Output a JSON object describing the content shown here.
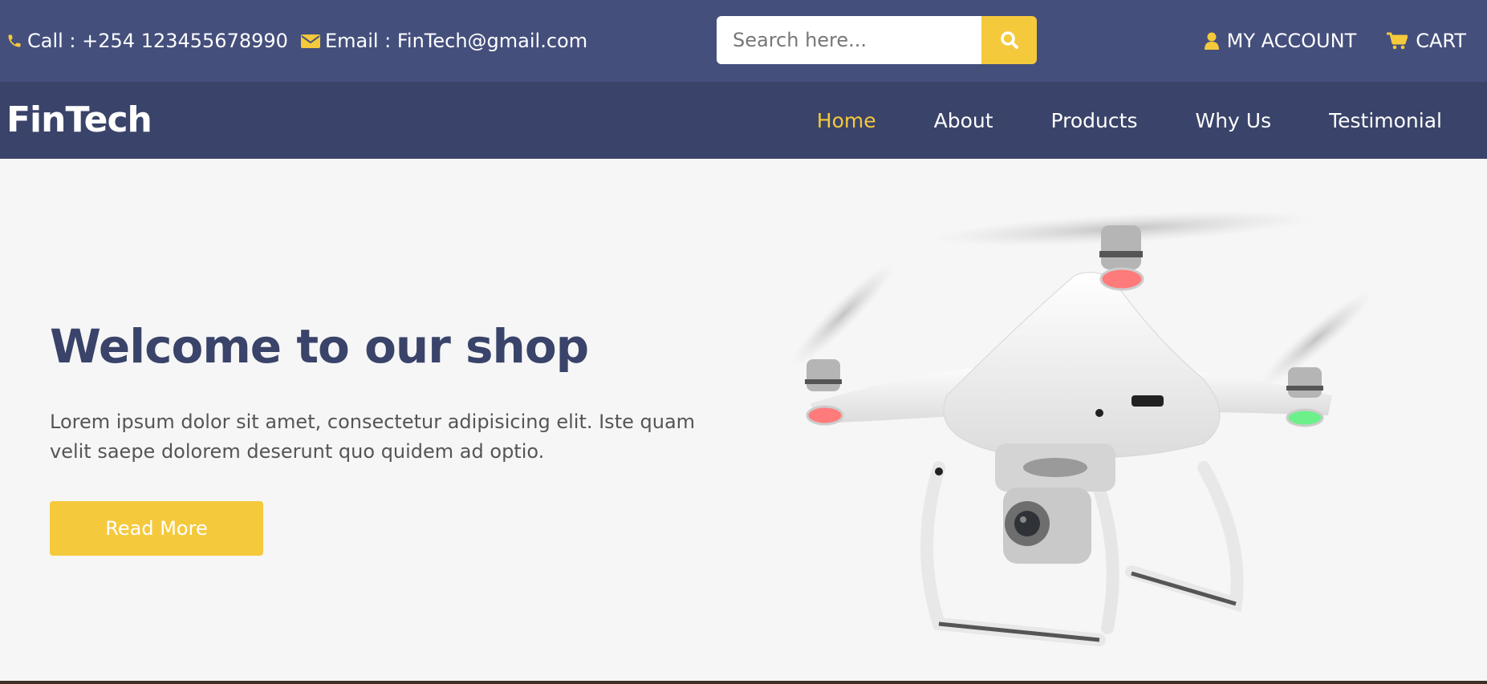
{
  "topbar": {
    "phone_label": "Call : +254 123455678990",
    "email_label": "Email : FinTech@gmail.com",
    "search": {
      "placeholder": "Search here..."
    },
    "account_label": "MY ACCOUNT",
    "cart_label": "CART"
  },
  "nav": {
    "logo": "FinTech",
    "items": [
      {
        "label": "Home",
        "active": true
      },
      {
        "label": "About"
      },
      {
        "label": "Products"
      },
      {
        "label": "Why Us"
      },
      {
        "label": "Testimonial"
      }
    ]
  },
  "hero": {
    "title": "Welcome to our shop",
    "text": "Lorem ipsum dolor sit amet, consectetur adipisicing elit. Iste quam velit saepe dolorem deserunt quo quidem ad optio.",
    "button_label": "Read More"
  },
  "colors": {
    "topbar_bg": "#444f7c",
    "navbar_bg": "#3a4369",
    "accent": "#f4c93c",
    "hero_bg": "#f6f6f6"
  },
  "icons": [
    "phone-icon",
    "envelope-icon",
    "search-icon",
    "user-icon",
    "cart-icon"
  ]
}
